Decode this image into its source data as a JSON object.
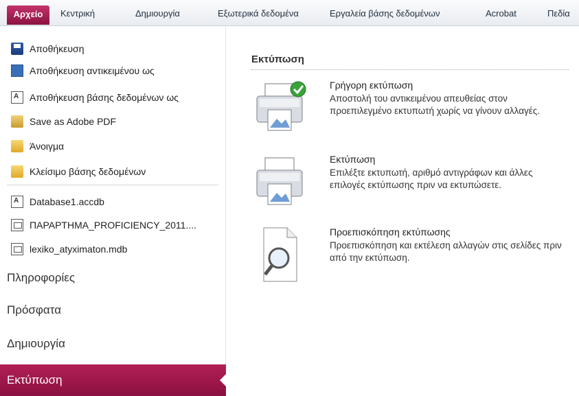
{
  "ribbon": {
    "tabs": [
      {
        "label": "Αρχείο",
        "active": true
      },
      {
        "label": "Κεντρική"
      },
      {
        "label": "Δημιουργία"
      },
      {
        "label": "Εξωτερικά δεδομένα"
      },
      {
        "label": "Εργαλεία βάσης δεδομένων"
      },
      {
        "label": "Acrobat"
      },
      {
        "label": "Πεδία"
      }
    ]
  },
  "left": {
    "commands": [
      {
        "label": "Αποθήκευση",
        "icon": "save-icon"
      },
      {
        "label": "Αποθήκευση αντικειμένου ως",
        "icon": "save-object-as-icon"
      },
      {
        "label": "Αποθήκευση βάσης δεδομένων ως",
        "icon": "save-database-as-icon"
      },
      {
        "label": "Save as Adobe PDF",
        "icon": "adobe-pdf-icon"
      },
      {
        "label": "Άνοιγμα",
        "icon": "open-folder-icon"
      },
      {
        "label": "Κλείσιμο βάσης δεδομένων",
        "icon": "close-database-icon"
      }
    ],
    "recent_files": [
      {
        "label": "Database1.accdb",
        "icon": "database-file-icon"
      },
      {
        "label": "ΠΑΡΑΡΤΗΜΑ_PROFICIENCY_2011....",
        "icon": "database-file-icon"
      },
      {
        "label": "lexiko_atyximaton.mdb",
        "icon": "database-file-icon"
      }
    ],
    "sections": [
      {
        "label": "Πληροφορίες"
      },
      {
        "label": "Πρόσφατα"
      },
      {
        "label": "Δημιουργία"
      },
      {
        "label": "Εκτύπωση",
        "active": true
      }
    ]
  },
  "print": {
    "title": "Εκτύπωση",
    "options": [
      {
        "title": "Γρήγορη εκτύπωση",
        "desc": "Αποστολή του αντικειμένου απευθείας στον προεπιλεγμένο εκτυπωτή χωρίς να γίνουν αλλαγές.",
        "icon": "quick-print-icon"
      },
      {
        "title": "Εκτύπωση",
        "desc": "Επιλέξτε εκτυπωτή, αριθμό αντιγράφων και άλλες επιλογές εκτύπωσης πριν να εκτυπώσετε.",
        "icon": "printer-icon"
      },
      {
        "title": "Προεπισκόπηση εκτύπωσης",
        "desc": "Προεπισκόπηση και εκτέλεση αλλαγών στις σελίδες πριν από την εκτύπωση.",
        "icon": "print-preview-icon"
      }
    ]
  },
  "colors": {
    "accent": "#a3184c",
    "tabbar": "#eef0f4"
  }
}
